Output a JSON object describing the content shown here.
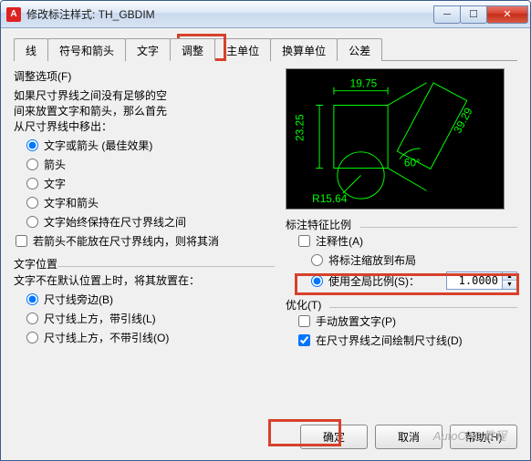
{
  "window": {
    "title": "修改标注样式: TH_GBDIM"
  },
  "tabs": [
    "线",
    "符号和箭头",
    "文字",
    "调整",
    "主单位",
    "换算单位",
    "公差"
  ],
  "active_tab": 3,
  "fit_options": {
    "title": "调整选项(F)",
    "desc1": "如果尺寸界线之间没有足够的空",
    "desc2": "间来放置文字和箭头，那么首先",
    "desc3": "从尺寸界线中移出：",
    "r1": "文字或箭头 (最佳效果)",
    "r2": "箭头",
    "r3": "文字",
    "r4": "文字和箭头",
    "r5": "文字始终保持在尺寸界线之间",
    "c1": "若箭头不能放在尺寸界线内，则将其消"
  },
  "text_pos": {
    "title": "文字位置",
    "desc": "文字不在默认位置上时，将其放置在：",
    "r1": "尺寸线旁边(B)",
    "r2": "尺寸线上方，带引线(L)",
    "r3": "尺寸线上方，不带引线(O)"
  },
  "scale": {
    "title": "标注特征比例",
    "c1": "注释性(A)",
    "r1": "将标注缩放到布局",
    "r2": "使用全局比例(S)：",
    "value": "1.0000"
  },
  "optimize": {
    "title": "优化(T)",
    "c1": "手动放置文字(P)",
    "c2": "在尺寸界线之间绘制尺寸线(D)"
  },
  "preview": {
    "w": "19.75",
    "h": "23.25",
    "r": "R15.64",
    "ang": "60°",
    "len": "39.29"
  },
  "buttons": {
    "ok": "确定",
    "cancel": "取消",
    "help": "帮助(H)"
  },
  "watermark": "AutoCAD教程"
}
